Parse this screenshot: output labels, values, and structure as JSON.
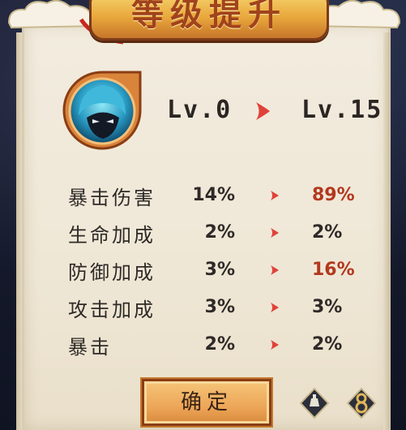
{
  "title": "等级提升",
  "level": {
    "from": "Lv.0",
    "to": "Lv.15"
  },
  "stats": [
    {
      "label": "暴击伤害",
      "old": "14%",
      "new": "89%",
      "increased": true
    },
    {
      "label": "生命加成",
      "old": "2%",
      "new": "2%",
      "increased": false
    },
    {
      "label": "防御加成",
      "old": "3%",
      "new": "16%",
      "increased": true
    },
    {
      "label": "攻击加成",
      "old": "3%",
      "new": "3%",
      "increased": false
    },
    {
      "label": "暴击",
      "old": "2%",
      "new": "2%",
      "increased": false
    }
  ],
  "confirm_label": "确定",
  "colors": {
    "accent": "#e0423a",
    "increase": "#b2381e",
    "text": "#2e2a27",
    "button": "#eda659"
  },
  "icons": {
    "avatar": "ninja-character-portrait",
    "side_left": "ink-brush-icon",
    "side_right": "rope-knot-icon",
    "arrow": "red-arrow-icon"
  }
}
